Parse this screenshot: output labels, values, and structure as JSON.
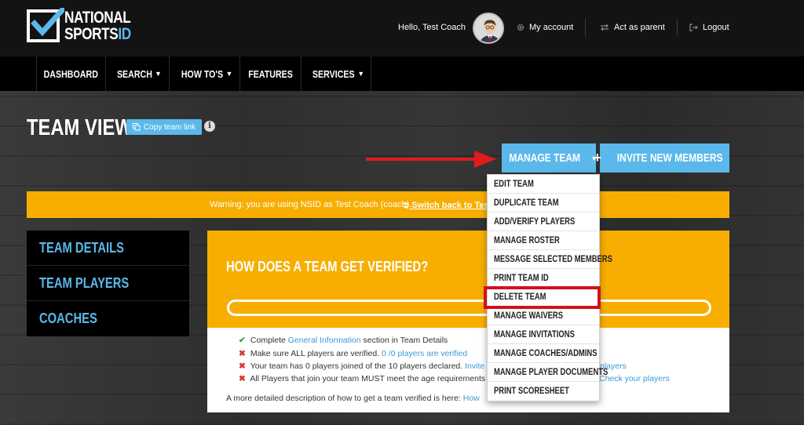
{
  "brand": {
    "logo_line1": "NATIONAL",
    "logo_line2a": "SPORTS",
    "logo_line2b": "ID"
  },
  "header": {
    "greeting": "Hello, Test Coach",
    "my_account": "My account",
    "act_as_parent": "Act as parent",
    "logout": "Logout"
  },
  "nav": {
    "items": [
      {
        "label": "DASHBOARD",
        "dropdown": false
      },
      {
        "label": "SEARCH",
        "dropdown": true
      },
      {
        "label": "HOW TO'S",
        "dropdown": true
      },
      {
        "label": "FEATURES",
        "dropdown": false
      },
      {
        "label": "SERVICES",
        "dropdown": true
      }
    ]
  },
  "page": {
    "title": "TEAM VIEW",
    "copy_link": "Copy team link",
    "info_glyph": "i",
    "manage_team": "MANAGE TEAM",
    "invite": "INVITE NEW MEMBERS"
  },
  "warning": {
    "message": "Warning: you are using NSID as Test Coach (coach).",
    "switch_link": "Switch back to Test"
  },
  "sidebar": {
    "items": [
      "TEAM DETAILS",
      "TEAM PLAYERS",
      "COACHES"
    ]
  },
  "verify": {
    "title": "HOW DOES A TEAM GET VERIFIED?",
    "progress": 0,
    "requirements": [
      {
        "status": "ok",
        "pre": "Complete ",
        "link": "General Information",
        "post": " section in Team Details"
      },
      {
        "status": "no",
        "pre": "Make sure ALL players are verified. ",
        "link": "0 /0 players are verified",
        "post": ""
      },
      {
        "status": "no",
        "pre": "Your team has 0 players joined of the 10 players declared. ",
        "link": "Invite m",
        "post": ""
      },
      {
        "status": "no",
        "pre": "All Players that join your team MUST meet the age requirements",
        "link": "",
        "post": ""
      }
    ],
    "right_links": [
      "players",
      "Check your players"
    ],
    "more_text": "A more detailed description of how to get a team verified is here: ",
    "more_link": "How"
  },
  "dropdown": {
    "items": [
      "EDIT TEAM",
      "DUPLICATE TEAM",
      "ADD/VERIFY PLAYERS",
      "MANAGE ROSTER",
      "MESSAGE SELECTED MEMBERS",
      "PRINT TEAM ID",
      "DELETE TEAM",
      "MANAGE WAIVERS",
      "MANAGE INVITATIONS",
      "MANAGE COACHES/ADMINS",
      "MANAGE PLAYER DOCUMENTS",
      "PRINT SCORESHEET"
    ],
    "highlighted_index": 6
  },
  "colors": {
    "accent_blue": "#5bb8ea",
    "warning_orange": "#f7ae00",
    "highlight_red": "#d0121b",
    "ok_green": "#39a13d",
    "error_red": "#d43b2c"
  }
}
